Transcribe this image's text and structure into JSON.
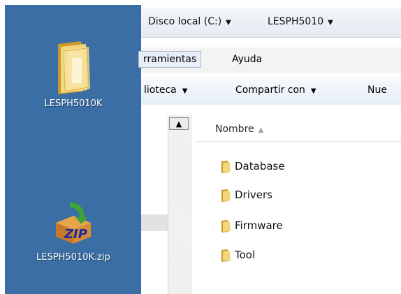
{
  "desktop": {
    "icons": [
      {
        "label": "LESPH5010K",
        "icon": "folder-icon"
      },
      {
        "label": "LESPH5010K.zip",
        "icon": "zip-archive-icon"
      }
    ],
    "background_color": "#3a6ea5"
  },
  "explorer": {
    "breadcrumb": [
      {
        "label": "Disco local (C:)"
      },
      {
        "label": "LESPH5010"
      }
    ],
    "menu": [
      {
        "label": "rramientas"
      },
      {
        "label": "Ayuda"
      }
    ],
    "toolbar": [
      {
        "label": "lioteca"
      },
      {
        "label": "Compartir con"
      },
      {
        "label": "Nue"
      }
    ],
    "column_header": {
      "label": "Nombre",
      "sort": "ascending"
    },
    "files": [
      {
        "name": "Database",
        "icon": "folder-icon"
      },
      {
        "name": "Drivers",
        "icon": "folder-icon"
      },
      {
        "name": "Firmware",
        "icon": "folder-icon"
      },
      {
        "name": "Tool",
        "icon": "folder-icon"
      }
    ]
  }
}
